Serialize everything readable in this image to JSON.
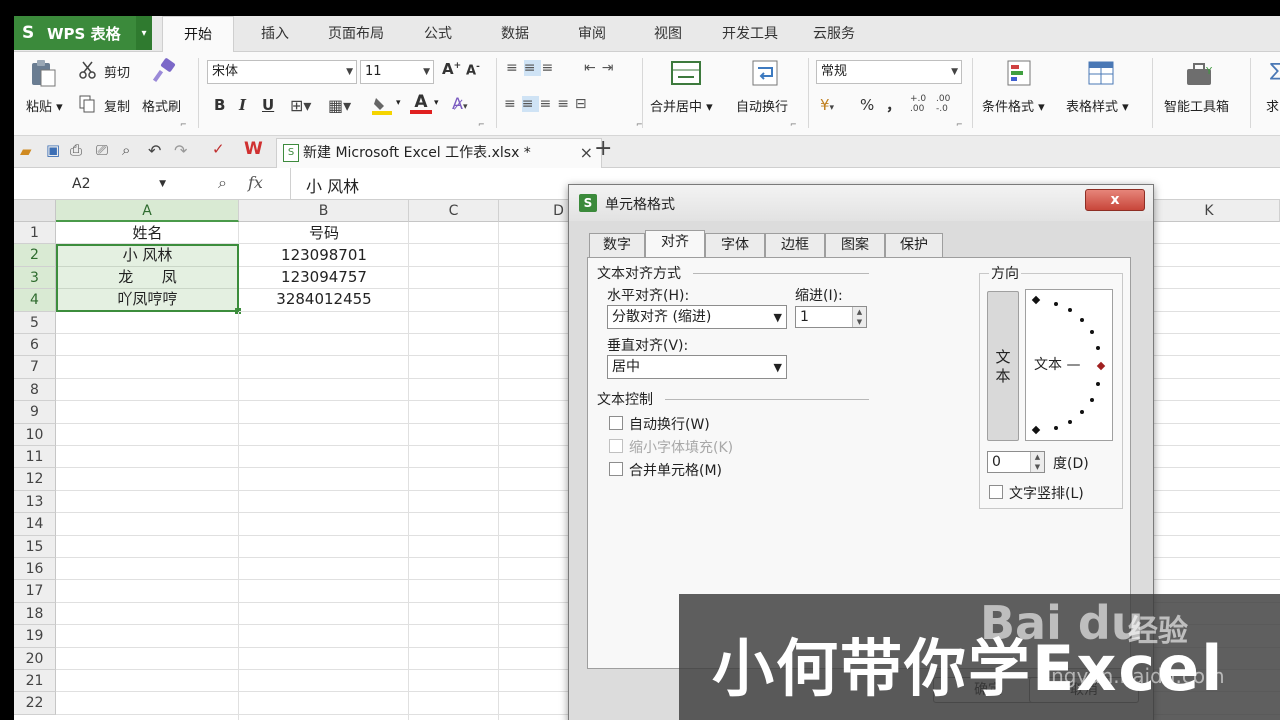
{
  "app": {
    "brand": "WPS 表格",
    "brand_logo": "S",
    "menu_tabs": [
      "开始",
      "插入",
      "页面布局",
      "公式",
      "数据",
      "审阅",
      "视图",
      "开发工具",
      "云服务"
    ]
  },
  "ribbon": {
    "paste": "粘贴",
    "cut": "剪切",
    "copy": "复制",
    "format_painter": "格式刷",
    "font_name": "宋体",
    "font_size": "11",
    "bold": "B",
    "italic": "I",
    "underline": "U",
    "font_color": "A",
    "merge_center": "合并居中",
    "wrap_text": "自动换行",
    "number_format": "常规",
    "percent": "%",
    "comma": "，",
    "cond_format": "条件格式",
    "table_style": "表格样式",
    "smart_tools": "智能工具箱",
    "more": "求"
  },
  "doc_tab": {
    "title": "新建 Microsoft Excel 工作表.xlsx *",
    "close": "×",
    "add": "+"
  },
  "formula_bar": {
    "name_box": "A2",
    "fx": "fx",
    "content": "小 风林"
  },
  "sheet": {
    "columns": [
      "A",
      "B",
      "C",
      "D",
      "K"
    ],
    "rows": [
      "1",
      "2",
      "3",
      "4",
      "5",
      "6",
      "7",
      "8",
      "9",
      "10",
      "11",
      "12",
      "13",
      "14",
      "15",
      "16",
      "17",
      "18",
      "19",
      "20",
      "21",
      "22"
    ],
    "cells": {
      "A1": "姓名",
      "B1": "号码",
      "A2": "小 风林",
      "B2": "123098701",
      "A3": "龙      凤",
      "B3": "123094757",
      "A4": "吖凤哼哼",
      "B4": "3284012455"
    }
  },
  "dialog": {
    "title": "单元格格式",
    "close": "x",
    "tabs": [
      "数字",
      "对齐",
      "字体",
      "边框",
      "图案",
      "保护"
    ],
    "active_tab": "对齐",
    "text_align_group": "文本对齐方式",
    "horizontal_label": "水平对齐(H):",
    "horizontal_value": "分散对齐 (缩进)",
    "indent_label": "缩进(I):",
    "indent_value": "1",
    "vertical_label": "垂直对齐(V):",
    "vertical_value": "居中",
    "text_control_group": "文本控制",
    "wrap_label": "自动换行(W)",
    "shrink_label": "缩小字体填充(K)",
    "merge_label": "合并单元格(M)",
    "orientation_group": "方向",
    "vertical_text": "文本",
    "dial_text": "文本 —",
    "degree_value": "0",
    "degree_label": "度(D)",
    "vertical_stack_label": "文字竖排(L)",
    "ok": "确定",
    "cancel": "取消"
  },
  "watermark": {
    "title": "小何带你学Excel",
    "baidu": "Bai du",
    "jingyan": "经验",
    "url": "jingyan.baidu.com"
  },
  "colors": {
    "brand_green": "#3b8a3b",
    "selection_green": "#3c8d3c",
    "close_red": "#c8463a"
  }
}
